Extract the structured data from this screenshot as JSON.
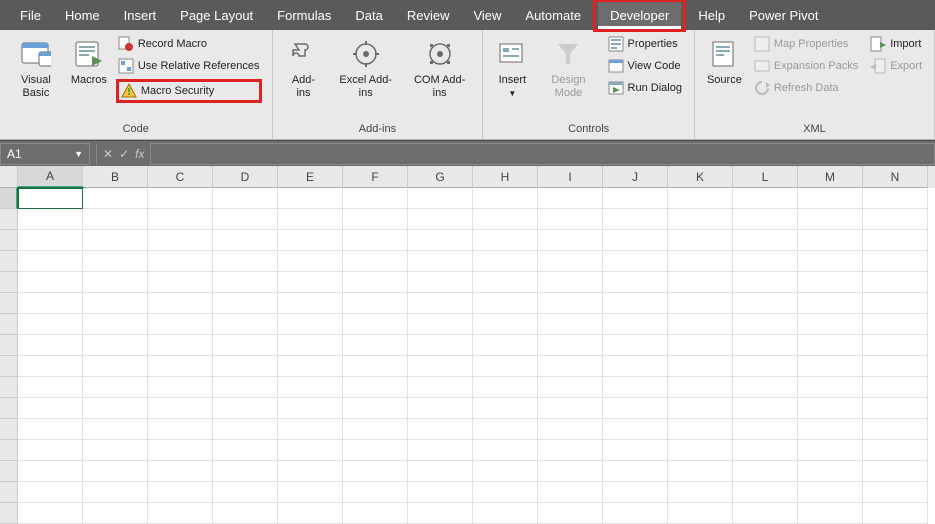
{
  "menu": {
    "tabs": [
      "File",
      "Home",
      "Insert",
      "Page Layout",
      "Formulas",
      "Data",
      "Review",
      "View",
      "Automate",
      "Developer",
      "Help",
      "Power Pivot"
    ],
    "active": "Developer"
  },
  "ribbon": {
    "code": {
      "label": "Code",
      "visualBasic": "Visual\nBasic",
      "macros": "Macros",
      "recordMacro": "Record Macro",
      "useRelative": "Use Relative References",
      "macroSecurity": "Macro Security"
    },
    "addins": {
      "label": "Add-ins",
      "addins": "Add-\nins",
      "excelAddins": "Excel\nAdd-ins",
      "comAddins": "COM\nAdd-ins"
    },
    "controls": {
      "label": "Controls",
      "insert": "Insert",
      "designMode": "Design\nMode",
      "properties": "Properties",
      "viewCode": "View Code",
      "runDialog": "Run Dialog"
    },
    "xml": {
      "label": "XML",
      "source": "Source",
      "mapProps": "Map Properties",
      "expansion": "Expansion Packs",
      "refresh": "Refresh Data",
      "import": "Import",
      "export": "Export"
    }
  },
  "namebox": "A1",
  "fx": "fx",
  "columns": [
    "A",
    "B",
    "C",
    "D",
    "E",
    "F",
    "G",
    "H",
    "I",
    "J",
    "K",
    "L",
    "M",
    "N"
  ],
  "rows": 16,
  "selected": {
    "col": 0,
    "row": 0
  }
}
